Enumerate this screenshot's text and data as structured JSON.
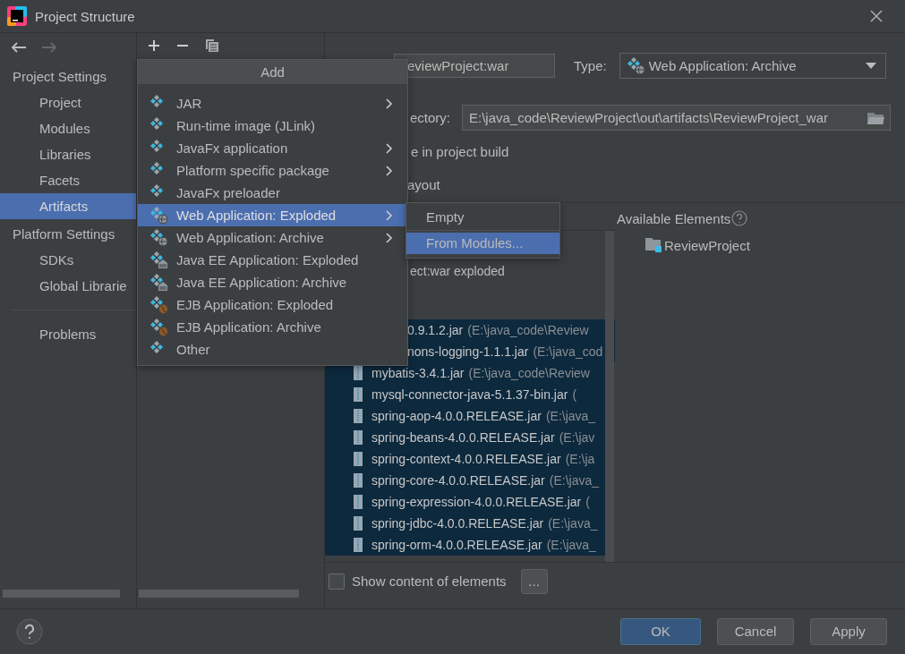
{
  "window": {
    "title": "Project Structure"
  },
  "sidebar": {
    "sections": [
      {
        "header": "Project Settings",
        "items": [
          {
            "label": "Project",
            "selected": false
          },
          {
            "label": "Modules",
            "selected": false
          },
          {
            "label": "Libraries",
            "selected": false
          },
          {
            "label": "Facets",
            "selected": false
          },
          {
            "label": "Artifacts",
            "selected": true
          }
        ]
      },
      {
        "header": "Platform Settings",
        "items": [
          {
            "label": "SDKs",
            "selected": false
          },
          {
            "label": "Global Librarie",
            "selected": false
          }
        ]
      }
    ],
    "problems": {
      "label": "Problems",
      "selected": false
    }
  },
  "add_menu": {
    "title": "Add",
    "items": [
      {
        "label": "JAR",
        "kind": "plain",
        "submenu": true,
        "selected": false
      },
      {
        "label": "Run-time image (JLink)",
        "kind": "plain",
        "submenu": false,
        "selected": false
      },
      {
        "label": "JavaFx application",
        "kind": "plain",
        "submenu": true,
        "selected": false
      },
      {
        "label": "Platform specific package",
        "kind": "plain",
        "submenu": true,
        "selected": false
      },
      {
        "label": "JavaFx preloader",
        "kind": "plain",
        "submenu": false,
        "selected": false
      },
      {
        "label": "Web Application: Exploded",
        "kind": "web",
        "submenu": true,
        "selected": true
      },
      {
        "label": "Web Application: Archive",
        "kind": "web",
        "submenu": true,
        "selected": false
      },
      {
        "label": "Java EE Application: Exploded",
        "kind": "ee",
        "submenu": false,
        "selected": false
      },
      {
        "label": "Java EE Application: Archive",
        "kind": "ee",
        "submenu": false,
        "selected": false
      },
      {
        "label": "EJB Application: Exploded",
        "kind": "ejb",
        "submenu": false,
        "selected": false
      },
      {
        "label": "EJB Application: Archive",
        "kind": "ejb",
        "submenu": false,
        "selected": false
      },
      {
        "label": "Other",
        "kind": "plain",
        "submenu": false,
        "selected": false
      }
    ]
  },
  "submenu": {
    "items": [
      {
        "label": "Empty",
        "selected": false
      },
      {
        "label": "From Modules...",
        "selected": true
      }
    ]
  },
  "artifact": {
    "name": "eviewProject:war",
    "type_label": "Type:",
    "type": "Web Application: Archive",
    "directory_label": "ectory:",
    "directory": "E:\\java_code\\ReviewProject\\out\\artifacts\\ReviewProject_war",
    "include_label": "e in project build",
    "layout_tab": "ayout"
  },
  "layout_tree": {
    "root": "ect:war exploded",
    "rows": [
      {
        "kind": "cut",
        "name": "0.9.1.2.jar",
        "path": "(E:\\java_code\\Review",
        "selected": true
      },
      {
        "kind": "cut",
        "name": "nons-logging-1.1.1.jar",
        "path": "(E:\\java_cod",
        "selected": true
      },
      {
        "kind": "jar",
        "name": "mybatis-3.4.1.jar",
        "path": "(E:\\java_code\\Review",
        "selected": true
      },
      {
        "kind": "jar",
        "name": "mysql-connector-java-5.1.37-bin.jar",
        "path": "(",
        "selected": true
      },
      {
        "kind": "jar",
        "name": "spring-aop-4.0.0.RELEASE.jar",
        "path": "(E:\\java_",
        "selected": true
      },
      {
        "kind": "jar",
        "name": "spring-beans-4.0.0.RELEASE.jar",
        "path": "(E:\\jav",
        "selected": true
      },
      {
        "kind": "jar",
        "name": "spring-context-4.0.0.RELEASE.jar",
        "path": "(E:\\ja",
        "selected": true
      },
      {
        "kind": "jar",
        "name": "spring-core-4.0.0.RELEASE.jar",
        "path": "(E:\\java_",
        "selected": true
      },
      {
        "kind": "jar",
        "name": "spring-expression-4.0.0.RELEASE.jar",
        "path": "(",
        "selected": true
      },
      {
        "kind": "jar",
        "name": "spring-jdbc-4.0.0.RELEASE.jar",
        "path": "(E:\\java_",
        "selected": true
      },
      {
        "kind": "jar",
        "name": "spring-orm-4.0.0.RELEASE.jar",
        "path": "(E:\\java_",
        "selected": true
      }
    ]
  },
  "available": {
    "title": "Available Elements",
    "items": [
      "ReviewProject"
    ]
  },
  "show_content": {
    "label": "Show content of elements",
    "checked": false
  },
  "more_button": "...",
  "buttons": [
    {
      "label": "OK",
      "kind": "primary"
    },
    {
      "label": "Cancel",
      "kind": "secondary"
    },
    {
      "label": "Apply",
      "kind": "secondary"
    }
  ]
}
